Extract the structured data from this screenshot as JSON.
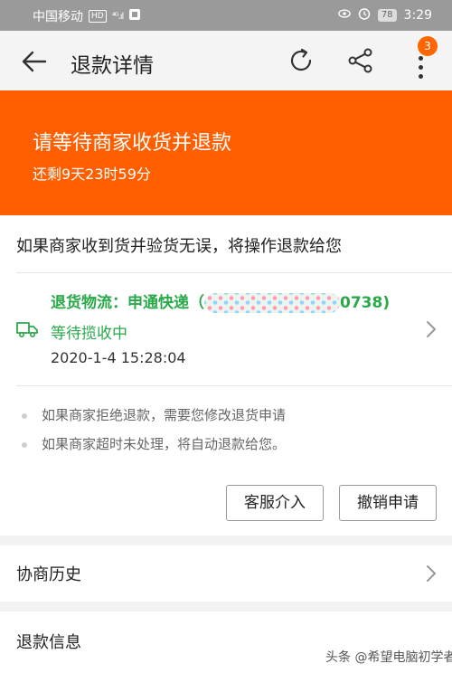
{
  "status_bar": {
    "carrier": "中国移动",
    "network_badge": "HD",
    "signal_text": "⁴ᴳ.ıl",
    "battery": "78",
    "time": "3:29"
  },
  "app_bar": {
    "title": "退款详情",
    "badge_count": "3"
  },
  "banner": {
    "headline": "请等待商家收货并退款",
    "countdown": "还剩9天23时59分",
    "color": "#ff5f00"
  },
  "card": {
    "notice": "如果商家收到货并验货无误，将操作退款给您",
    "logistics": {
      "label_prefix": "退货物流：申通快递（",
      "label_suffix": "0738)",
      "status": "等待揽收中",
      "time": "2020-1-4 15:28:04",
      "accent_color": "#2aa84a"
    },
    "tips": [
      "如果商家拒绝退款，需要您修改退货申请",
      "如果商家超时未处理，将自动退款给您。"
    ],
    "buttons": {
      "service": "客服介入",
      "cancel": "撤销申请"
    }
  },
  "rows": {
    "history": "协商历史",
    "refund_info": "退款信息"
  },
  "watermark": "头条 @希望电脑初学者"
}
